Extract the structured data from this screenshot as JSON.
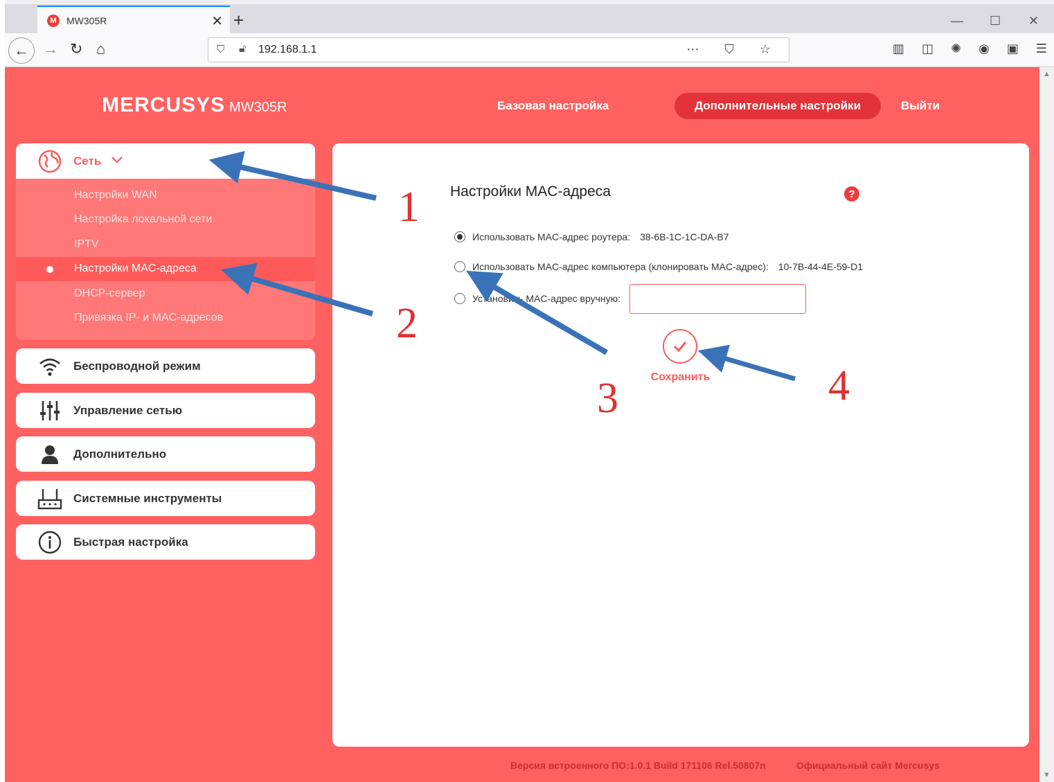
{
  "browser": {
    "tab_title": "MW305R",
    "tab_favicon": "M",
    "url": "192.168.1.1",
    "new_tab_label": "+",
    "close_tab": "✕"
  },
  "header": {
    "logo": "MERCUSYS",
    "model": "MW305R",
    "nav": {
      "basic": "Базовая настройка",
      "advanced": "Дополнительные настройки",
      "logout": "Выйти"
    }
  },
  "sidebar": {
    "network": {
      "label": "Сеть",
      "icon": "globe-icon",
      "items": [
        {
          "label": "Настройки WAN"
        },
        {
          "label": "Настройка локальной сети"
        },
        {
          "label": "IPTV"
        },
        {
          "label": "Настройки MAC-адреса"
        },
        {
          "label": "DHCP-сервер"
        },
        {
          "label": "Привязка IP- и MAC-адресов"
        }
      ]
    },
    "groups": [
      {
        "label": "Беспроводной режим",
        "icon": "wifi-icon"
      },
      {
        "label": "Управление сетью",
        "icon": "sliders-icon"
      },
      {
        "label": "Дополнительно",
        "icon": "user-icon"
      },
      {
        "label": "Системные инструменты",
        "icon": "router-icon"
      },
      {
        "label": "Быстрая настройка",
        "icon": "info-icon"
      }
    ]
  },
  "content": {
    "title": "Настройки MAC-адреса",
    "help": "?",
    "options": [
      {
        "label": "Использовать MAC-адрес роутера:",
        "value": "38-6B-1C-1C-DA-B7",
        "checked": true
      },
      {
        "label": "Использовать MAC-адрес компьютера (клонировать MAC-адрес):",
        "value": "10-7B-44-4E-59-D1",
        "checked": false
      },
      {
        "label": "Установить MAC-адрес вручную:",
        "value": "",
        "checked": false
      }
    ],
    "save_label": "Сохранить"
  },
  "footer": {
    "firmware": "Версия встроенного ПО:1.0.1 Build 171106 Rel.50807n",
    "site": "Официальный сайт Mercusys"
  },
  "annotations": {
    "n1": "1",
    "n2": "2",
    "n3": "3",
    "n4": "4"
  },
  "colors": {
    "brand": "#ff6161",
    "accent": "#e3323a",
    "arrow": "#3a72b8",
    "annotation_number": "#e03030"
  }
}
